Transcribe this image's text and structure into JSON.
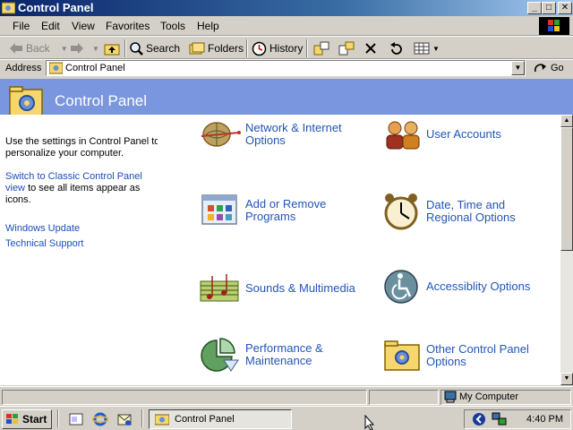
{
  "window": {
    "title": "Control Panel"
  },
  "title_buttons": {
    "minimize": "_",
    "maximize": "□",
    "close": "✕"
  },
  "menu": [
    "File",
    "Edit",
    "View",
    "Favorites",
    "Tools",
    "Help"
  ],
  "toolbar": {
    "back": "Back",
    "search": "Search",
    "folders": "Folders",
    "history": "History"
  },
  "address": {
    "label": "Address",
    "value": "Control Panel",
    "go": "Go"
  },
  "panel": {
    "title": "Control Panel"
  },
  "left_pane": {
    "intro": "Use the settings in Control Panel to personalize your computer.",
    "switch_link": "Switch to Classic Control Panel view",
    "switch_suffix": " to see all items appear as icons.",
    "links": [
      "Windows Update",
      "Technical Support"
    ]
  },
  "categories": [
    {
      "label": "Network & Internet Options",
      "icon": "globe-icon"
    },
    {
      "label": "User Accounts",
      "icon": "users-icon"
    },
    {
      "label": "Add or Remove Programs",
      "icon": "programs-icon"
    },
    {
      "label": "Date, Time and Regional Options",
      "icon": "clock-icon"
    },
    {
      "label": "Sounds & Multimedia",
      "icon": "music-icon"
    },
    {
      "label": "Accessiblity Options",
      "icon": "accessibility-icon"
    },
    {
      "label": "Performance & Maintenance",
      "icon": "pie-chart-icon"
    },
    {
      "label": "Other Control Panel Options",
      "icon": "folder-gear-icon"
    }
  ],
  "status": {
    "zone": "My Computer"
  },
  "taskbar": {
    "start": "Start",
    "task": "Control Panel",
    "clock": "4:40 PM"
  },
  "colors": {
    "title_bar": "#0a246a",
    "header_band": "#7a96df",
    "link": "#2155b6",
    "chrome": "#d4d0c8"
  }
}
